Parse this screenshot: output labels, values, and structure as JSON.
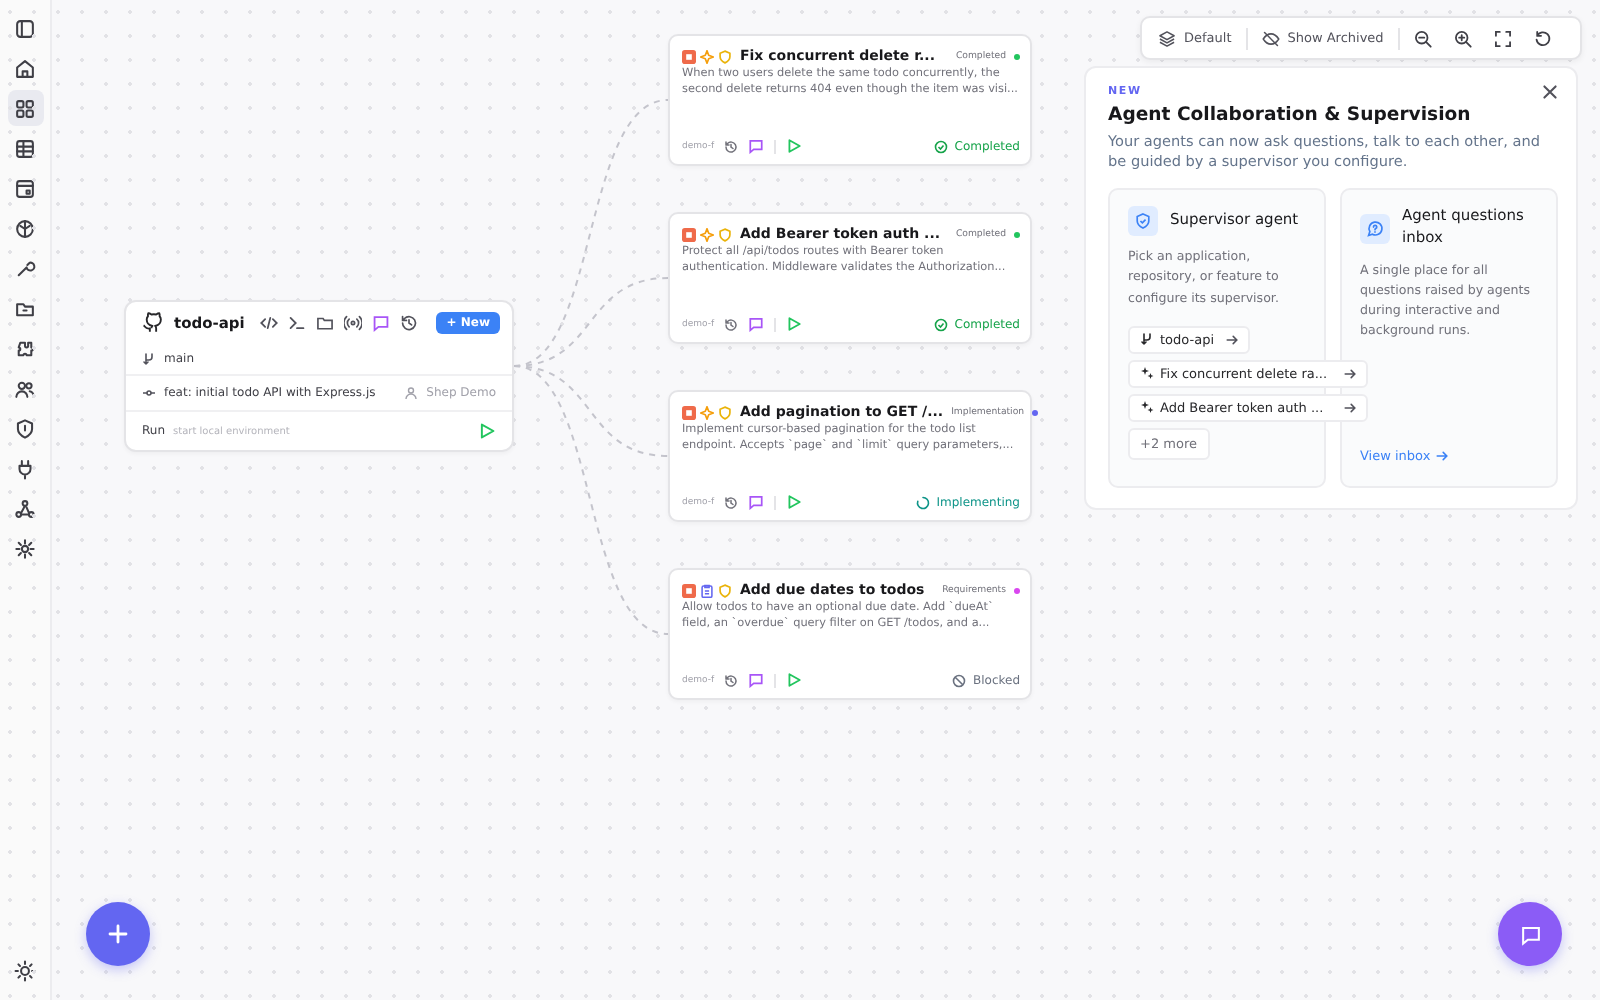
{
  "sidebar": {
    "items": [
      {
        "selected": false
      },
      {
        "selected": false
      },
      {
        "selected": true
      },
      {
        "selected": false
      },
      {
        "selected": false
      },
      {
        "selected": false
      },
      {
        "selected": false
      },
      {
        "selected": false
      },
      {
        "selected": false
      },
      {
        "selected": false
      },
      {
        "selected": false
      },
      {
        "selected": false
      },
      {
        "selected": false
      },
      {
        "selected": false
      }
    ]
  },
  "repo": {
    "name": "todo-api",
    "new_button": "+ New",
    "branch": "main",
    "commit": "feat: initial todo API with Express.js",
    "author": "Shep Demo",
    "run_label": "Run",
    "run_hint": "start local environment"
  },
  "features": [
    {
      "title": "Fix concurrent delete r...",
      "description": "When two users delete the same todo concurrently, the second delete returns 404 even though the item was visi...",
      "phase": "Completed",
      "color": "#22c55e",
      "kind": "sparkle",
      "branch": "demo-f",
      "status": {
        "kind": "completed",
        "text": "Completed"
      }
    },
    {
      "title": "Add Bearer token auth ...",
      "description": "Protect all /api/todos routes with Bearer token authentication. Middleware validates the Authorization...",
      "phase": "Completed",
      "color": "#22c55e",
      "kind": "sparkle",
      "branch": "demo-f",
      "status": {
        "kind": "completed",
        "text": "Completed"
      }
    },
    {
      "title": "Add pagination to GET /...",
      "description": "Implement cursor-based pagination for the todo list endpoint. Accepts `page` and `limit` query parameters,...",
      "phase": "Implementation",
      "color": "#6366f1",
      "kind": "sparkle",
      "branch": "demo-f",
      "status": {
        "kind": "implementing",
        "text": "Implementing"
      }
    },
    {
      "title": "Add due dates to todos",
      "description": "Allow todos to have an optional due date. Add `dueAt` field, an `overdue` query filter on GET /todos, and a...",
      "phase": "Requirements",
      "color": "#d946ef",
      "kind": "clipboard",
      "branch": "demo-f",
      "status": {
        "kind": "blocked",
        "text": "Blocked"
      }
    }
  ],
  "toolbar": {
    "view": "Default",
    "archived": "Show Archived"
  },
  "announcement": {
    "badge": "NEW",
    "title": "Agent Collaboration & Supervision",
    "text": "Your agents can now ask questions, talk to each other, and be guided by a supervisor you configure.",
    "supervisor": {
      "title": "Supervisor agent",
      "text": "Pick an application, repository, or feature to configure its supervisor.",
      "chips": [
        {
          "kind": "repo",
          "label": "todo-api"
        },
        {
          "kind": "feature",
          "label": "Fix concurrent delete ra..."
        },
        {
          "kind": "feature",
          "label": "Add Bearer token auth ..."
        }
      ],
      "more": "+2 more"
    },
    "inbox": {
      "title": "Agent questions inbox",
      "text": "A single place for all questions raised by agents during interactive and background runs.",
      "link": "View inbox"
    }
  }
}
